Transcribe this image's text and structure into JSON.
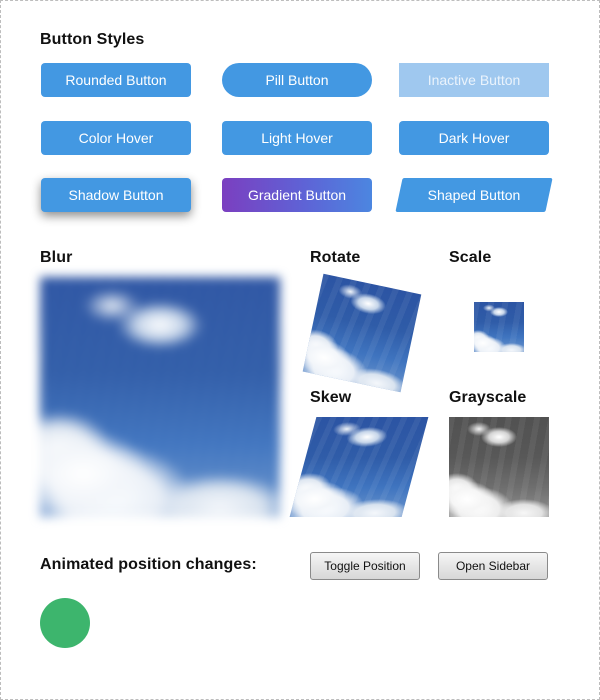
{
  "sections": {
    "button_styles": "Button Styles",
    "blur": "Blur",
    "rotate": "Rotate",
    "scale": "Scale",
    "skew": "Skew",
    "grayscale": "Grayscale",
    "animated": "Animated position changes:"
  },
  "buttons": {
    "rounded": "Rounded Button",
    "pill": "Pill Button",
    "inactive": "Inactive Button",
    "color_hover": "Color Hover",
    "light_hover": "Light Hover",
    "dark_hover": "Dark Hover",
    "shadow": "Shadow Button",
    "gradient": "Gradient Button",
    "shaped": "Shaped Button"
  },
  "controls": {
    "toggle_position": "Toggle Position",
    "open_sidebar": "Open Sidebar"
  },
  "colors": {
    "primary": "#4398e2",
    "inactive": "#9fc8ef",
    "gradient_start": "#7b3fc0",
    "gradient_end": "#4c86e0",
    "circle": "#3db56d"
  }
}
